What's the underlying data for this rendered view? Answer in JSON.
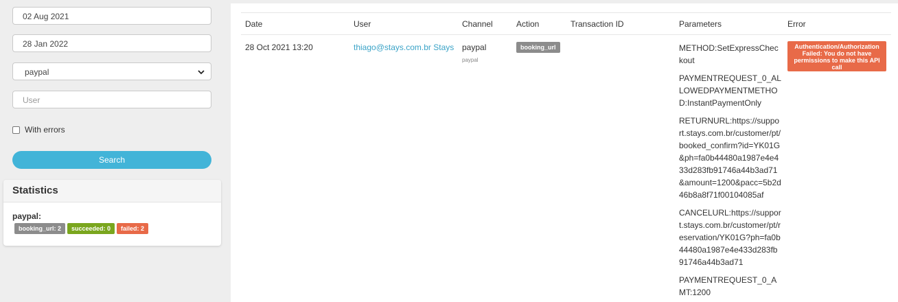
{
  "filters": {
    "date_from": "02 Aug 2021",
    "date_to": "28 Jan 2022",
    "channel_selected": "paypal",
    "user_placeholder": "User",
    "with_errors_label": "With errors",
    "search_label": "Search"
  },
  "statistics": {
    "title": "Statistics",
    "channel": "paypal:",
    "badges": {
      "booking_url": "booking_url: 2",
      "succeeded": "succeeded: 0",
      "failed": "failed: 2"
    }
  },
  "table": {
    "headers": {
      "date": "Date",
      "user": "User",
      "channel": "Channel",
      "action": "Action",
      "transaction_id": "Transaction ID",
      "parameters": "Parameters",
      "error": "Error"
    },
    "row": {
      "date": "28 Oct 2021 13:20",
      "user": "thiago@stays.com.br Stays",
      "channel": "paypal",
      "channel_sub": "paypal",
      "action": "booking_url",
      "transaction_id": "",
      "parameters": [
        "METHOD:SetExpressCheckout",
        "PAYMENTREQUEST_0_ALLOWEDPAYMENTMETHOD:InstantPaymentOnly",
        "RETURNURL:https://support.stays.com.br/customer/pt/booked_confirm?id=YK01G&ph=fa0b44480a1987e4e433d283fb91746a44b3ad71&amount=1200&pacc=5b2d46b8a8f71f00104085af",
        "CANCELURL:https://support.stays.com.br/customer/pt/reservation/YK01G?ph=fa0b44480a1987e4e433d283fb91746a44b3ad71",
        "PAYMENTREQUEST_0_AMT:1200"
      ],
      "error": "Authentication/Authorization Failed: You do not have permissions to make this API call"
    }
  },
  "colors": {
    "accent": "#42b4d8",
    "link": "#3aa3c7",
    "badge_grey": "#8c8c8c",
    "badge_green": "#7aa61e",
    "badge_red": "#e86a48"
  }
}
